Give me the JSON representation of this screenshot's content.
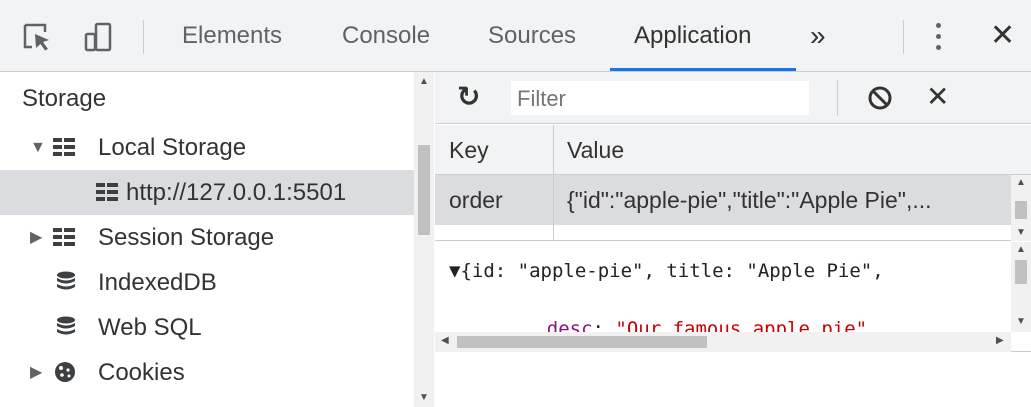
{
  "tabbar": {
    "tabs": [
      {
        "label": "Elements",
        "active": false
      },
      {
        "label": "Console",
        "active": false
      },
      {
        "label": "Sources",
        "active": false
      },
      {
        "label": "Application",
        "active": true
      }
    ],
    "overflow_glyph": "»",
    "close_glyph": "✕",
    "accent_color": "#1a73e8"
  },
  "sidebar": {
    "section_title": "Storage",
    "items": [
      {
        "label": "Local Storage",
        "icon": "grid-storage-icon",
        "expanded": true
      },
      {
        "label": "http://127.0.0.1:5501",
        "icon": "grid-storage-icon",
        "selected": true
      },
      {
        "label": "Session Storage",
        "icon": "grid-storage-icon",
        "expanded": false
      },
      {
        "label": "IndexedDB",
        "icon": "database-icon"
      },
      {
        "label": "Web SQL",
        "icon": "database-icon"
      },
      {
        "label": "Cookies",
        "icon": "cookie-icon",
        "expanded": false
      }
    ]
  },
  "toolbar": {
    "filter_placeholder": "Filter",
    "filter_value": ""
  },
  "table": {
    "columns": [
      "Key",
      "Value"
    ],
    "rows": [
      {
        "key": "order",
        "value": "{\"id\":\"apple-pie\",\"title\":\"Apple Pie\",..."
      }
    ]
  },
  "preview": {
    "line1": "▼{id: \"apple-pie\", title: \"Apple Pie\",",
    "line2_key": "desc",
    "line2_colon": ": ",
    "line2_value": "\"Our famous apple pie\""
  }
}
